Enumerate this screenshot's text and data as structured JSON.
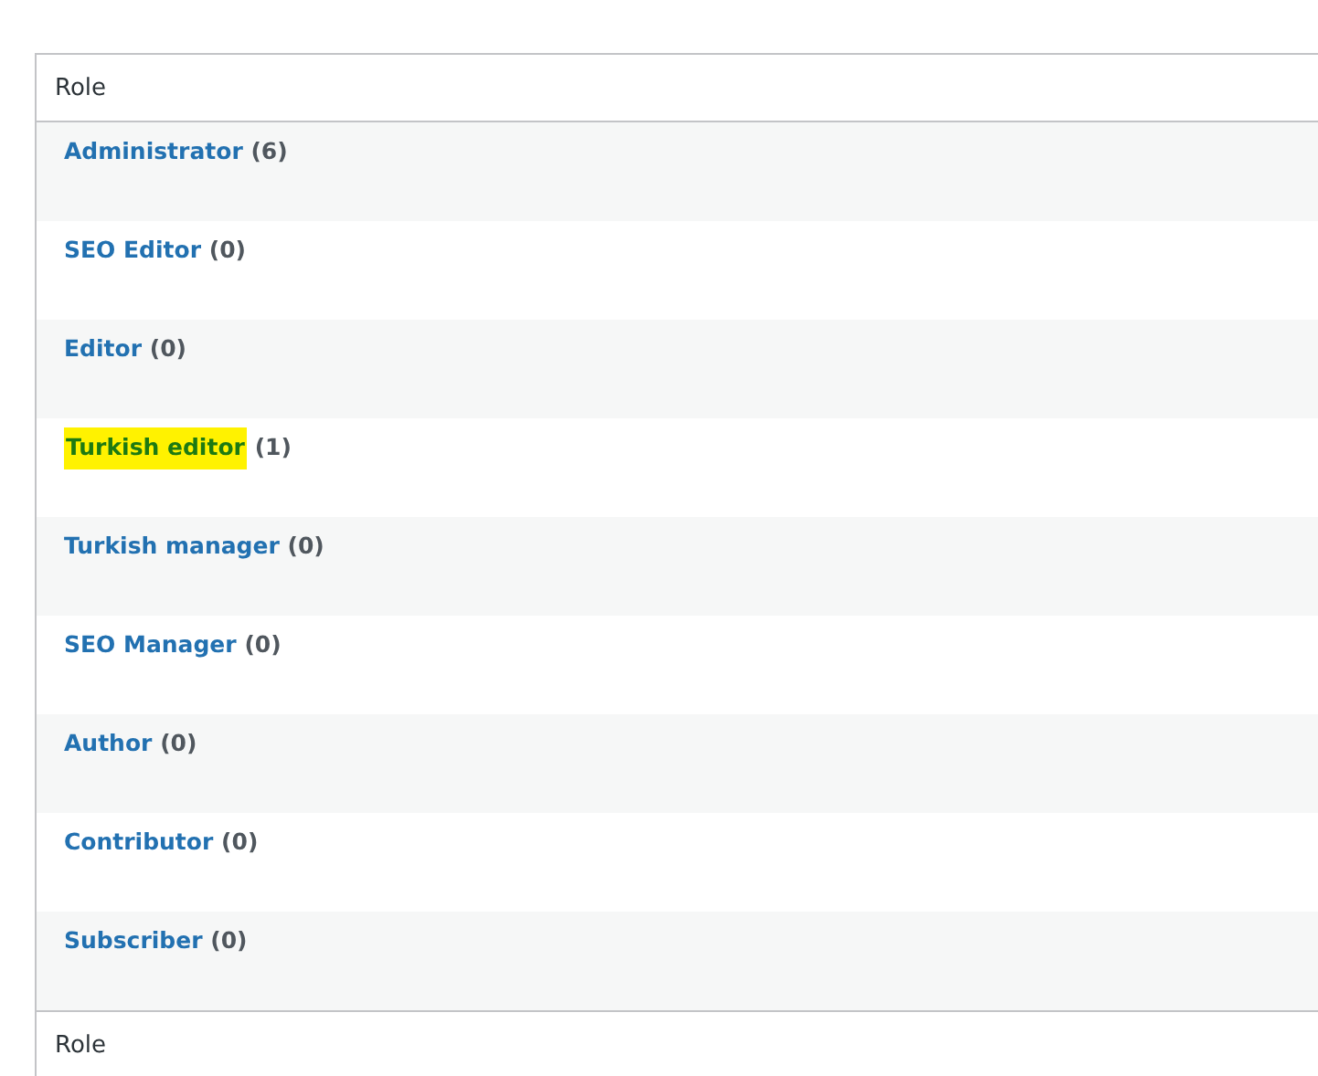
{
  "table": {
    "columns": [
      "Role"
    ],
    "rows": [
      {
        "role": "Administrator",
        "count": "(6)",
        "highlighted": false
      },
      {
        "role": "SEO Editor",
        "count": "(0)",
        "highlighted": false
      },
      {
        "role": "Editor",
        "count": "(0)",
        "highlighted": false
      },
      {
        "role": "Turkish editor",
        "count": "(1)",
        "highlighted": true
      },
      {
        "role": "Turkish manager",
        "count": "(0)",
        "highlighted": false
      },
      {
        "role": "SEO Manager",
        "count": "(0)",
        "highlighted": false
      },
      {
        "role": "Author",
        "count": "(0)",
        "highlighted": false
      },
      {
        "role": "Contributor",
        "count": "(0)",
        "highlighted": false
      },
      {
        "role": "Subscriber",
        "count": "(0)",
        "highlighted": false
      }
    ],
    "footer_columns": [
      "Role"
    ]
  }
}
